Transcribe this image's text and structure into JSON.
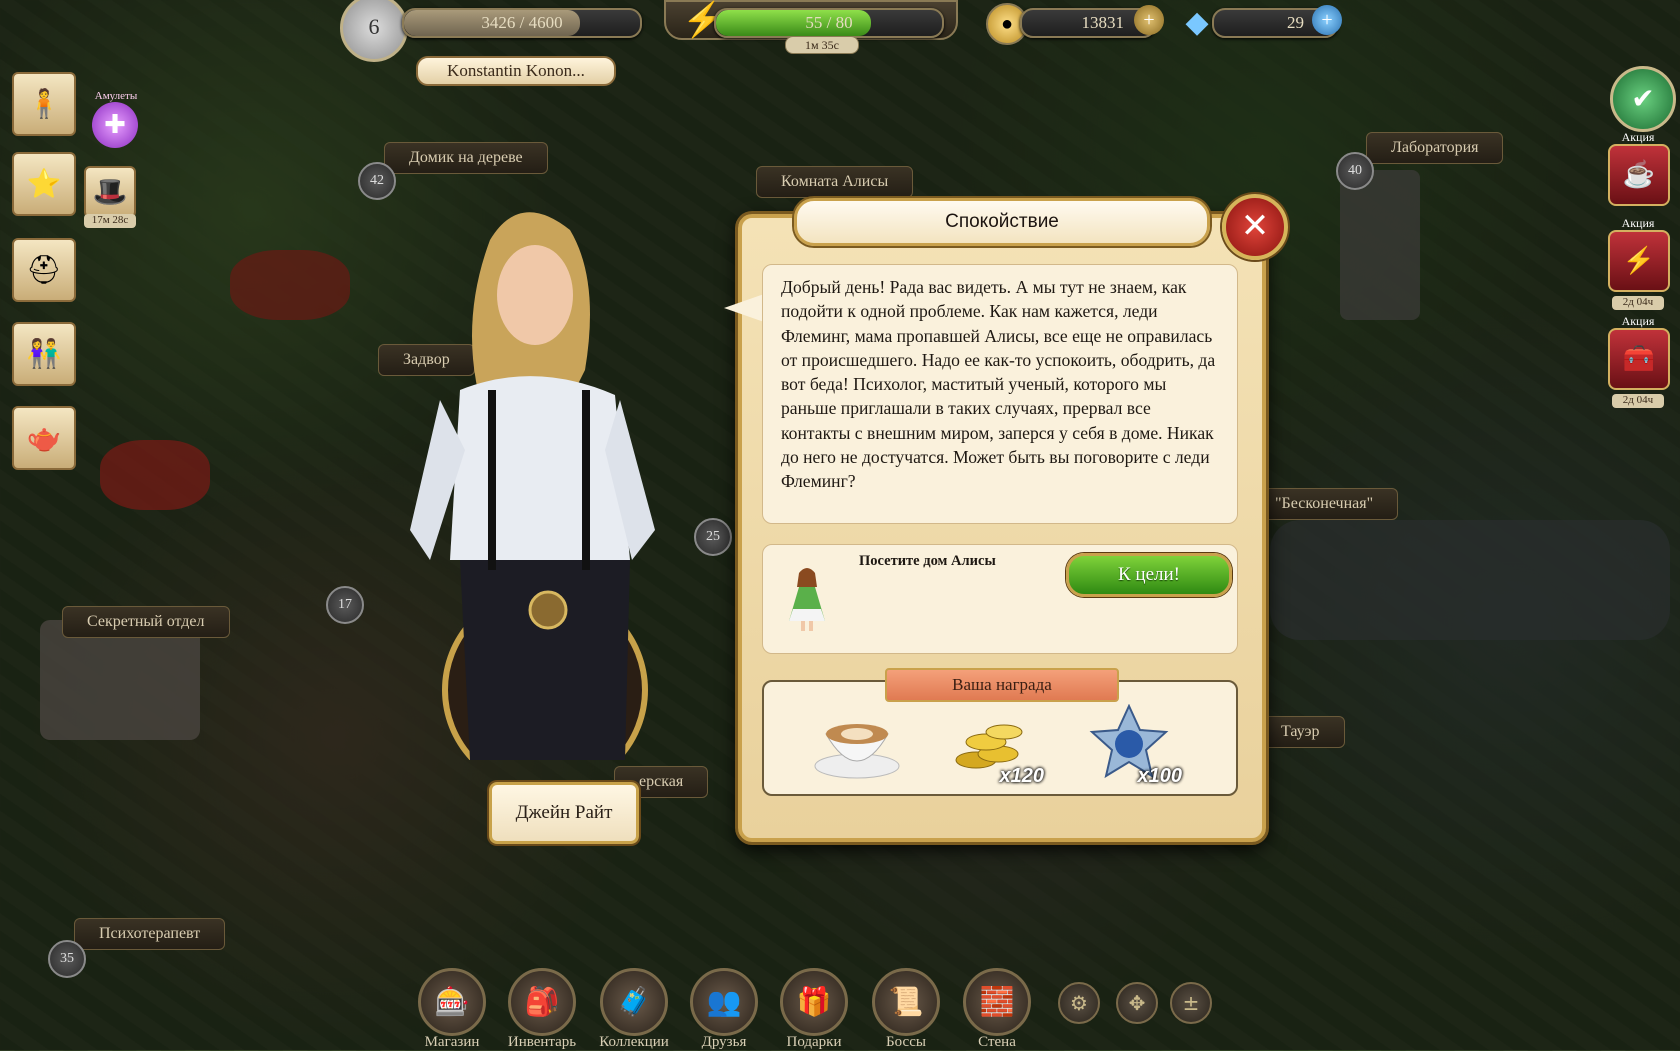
{
  "hud": {
    "level": "6",
    "xp": "3426 / 4600",
    "xp_fraction": 0.745,
    "player_name": "Konstantin Konon...",
    "energy": "55 / 80",
    "energy_fraction": 0.6875,
    "energy_timer": "1м 35с",
    "coins": "13831",
    "gems": "29"
  },
  "map_labels": {
    "treehouse": "Домик на дереве",
    "alice_room": "Комната Алисы",
    "laboratory": "Лаборатория",
    "secret_dept": "Секретный отдел",
    "zadvor": "Задвор",
    "endless": "\"Бесконечная\"",
    "tower": "Тауэр",
    "psychotherapist": "Психотерапевт",
    "erskaya": "ерская",
    "num_42": "42",
    "num_40": "40",
    "num_25": "25",
    "num_17": "17",
    "num_35": "35"
  },
  "left_sidebar": {
    "amulets_label": "Амулеты",
    "timer": "17м 28с"
  },
  "right_sidebar": {
    "promo_label": "Акция",
    "timer": "2д 04ч"
  },
  "character": {
    "name": "Джейн Райт"
  },
  "dialog": {
    "title": "Спокойствие",
    "close": "✕",
    "story": "Добрый день! Рада вас видеть. А мы тут не знаем, как подойти к одной проблеме. Как нам кажется, леди Флеминг, мама пропавшей Алисы, все еще не оправилась от происшедшего. Надо ее как-то успокоить, ободрить, да вот беда! Психолог, маститый ученый, которого мы раньше приглашали в таких случаях, прервал все контакты с внешним миром, заперся у себя в доме. Никак до него не достучатся. Может быть вы поговорите с леди Флеминг?",
    "task_text": "Посетите дом Алисы",
    "goal_button": "К цели!",
    "reward_title": "Ваша награда",
    "rewards": [
      {
        "icon": "coffee-cup-icon",
        "qty": ""
      },
      {
        "icon": "gold-coins-icon",
        "qty": "x120"
      },
      {
        "icon": "xp-star-icon",
        "qty": "x100"
      }
    ]
  },
  "bottom_bar": {
    "shop": "Магазин",
    "inventory": "Инвентарь",
    "collections": "Коллекции",
    "friends": "Друзья",
    "gifts": "Подарки",
    "bosses": "Боссы",
    "wall": "Стена"
  },
  "colors": {
    "accent_gold": "#c9a14c",
    "goal_green": "#2f8a12",
    "close_red": "#8a1410",
    "ribbon": "#e07a52"
  }
}
